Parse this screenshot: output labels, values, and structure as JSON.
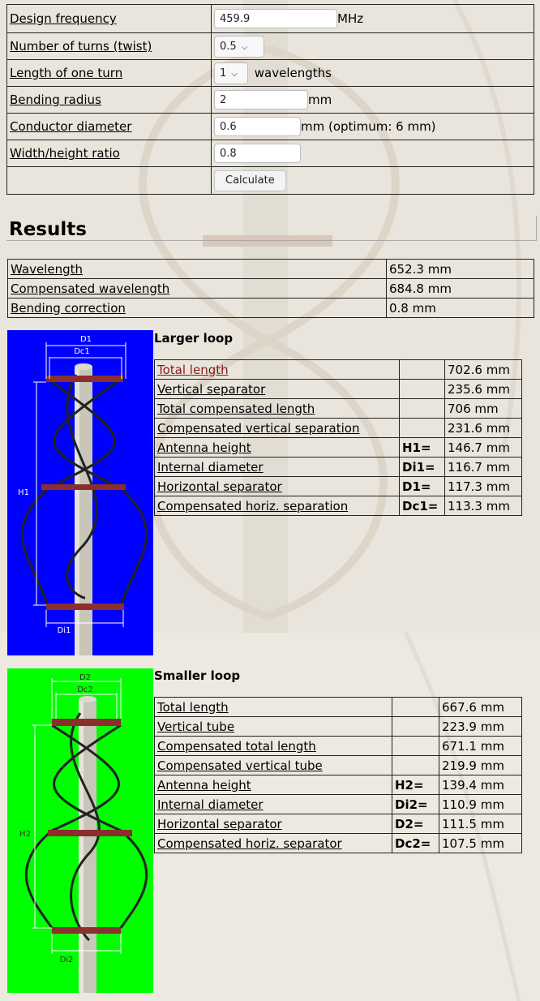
{
  "form": {
    "design_frequency": {
      "label": "Design frequency",
      "value": "459.9",
      "unit": "MHz"
    },
    "number_of_turns": {
      "label": "Number of turns (twist)",
      "selected": "0.5"
    },
    "length_of_one_turn": {
      "label": "Length of one turn",
      "selected": "1",
      "unit": "wavelengths"
    },
    "bending_radius": {
      "label": "Bending radius",
      "value": "2",
      "unit": "mm"
    },
    "conductor_diameter": {
      "label": "Conductor diameter",
      "value": "0.6",
      "unit": "mm (optimum: 6 mm)"
    },
    "width_height_ratio": {
      "label": "Width/height ratio",
      "value": "0.8"
    },
    "calculate_label": "Calculate"
  },
  "results": {
    "heading": "Results",
    "rows": [
      {
        "label": "Wavelength",
        "value": "652.3 mm"
      },
      {
        "label": "Compensated wavelength",
        "value": "684.8 mm"
      },
      {
        "label": "Bending correction",
        "value": "0.8 mm"
      }
    ]
  },
  "larger_loop": {
    "title": "Larger loop",
    "diagram_labels": {
      "d": "D1",
      "dc": "Dc1",
      "h": "H1",
      "di": "Di1"
    },
    "diagram_background": "#0000ff",
    "rows": [
      {
        "label": "Total length",
        "key": "",
        "value": "702.6 mm"
      },
      {
        "label": "Vertical separator",
        "key": "",
        "value": "235.6 mm"
      },
      {
        "label": "Total compensated length",
        "key": "",
        "value": "706 mm"
      },
      {
        "label": "Compensated vertical separation",
        "key": "",
        "value": "231.6 mm"
      },
      {
        "label": "Antenna height",
        "key": "H1=",
        "value": "146.7 mm"
      },
      {
        "label": "Internal diameter",
        "key": "Di1=",
        "value": "116.7 mm"
      },
      {
        "label": "Horizontal separator",
        "key": "D1=",
        "value": "117.3 mm"
      },
      {
        "label": "Compensated horiz. separation",
        "key": "Dc1=",
        "value": "113.3 mm"
      }
    ]
  },
  "smaller_loop": {
    "title": "Smaller loop",
    "diagram_labels": {
      "d": "D2",
      "dc": "Dc2",
      "h": "H2",
      "di": "Di2"
    },
    "diagram_background": "#00ff00",
    "rows": [
      {
        "label": "Total length",
        "key": "",
        "value": "667.6 mm"
      },
      {
        "label": "Vertical tube",
        "key": "",
        "value": "223.9 mm"
      },
      {
        "label": "Compensated total length",
        "key": "",
        "value": "671.1 mm"
      },
      {
        "label": "Compensated vertical tube",
        "key": "",
        "value": "219.9 mm"
      },
      {
        "label": "Antenna height",
        "key": "H2=",
        "value": "139.4 mm"
      },
      {
        "label": "Internal diameter",
        "key": "Di2=",
        "value": "110.9 mm"
      },
      {
        "label": "Horizontal separator",
        "key": "D2=",
        "value": "111.5 mm"
      },
      {
        "label": "Compensated horiz. separator",
        "key": "Dc2=",
        "value": "107.5 mm"
      }
    ]
  },
  "colors": {
    "page_bg": "#ede9e0",
    "link_highlight": "#8b1a1a"
  }
}
